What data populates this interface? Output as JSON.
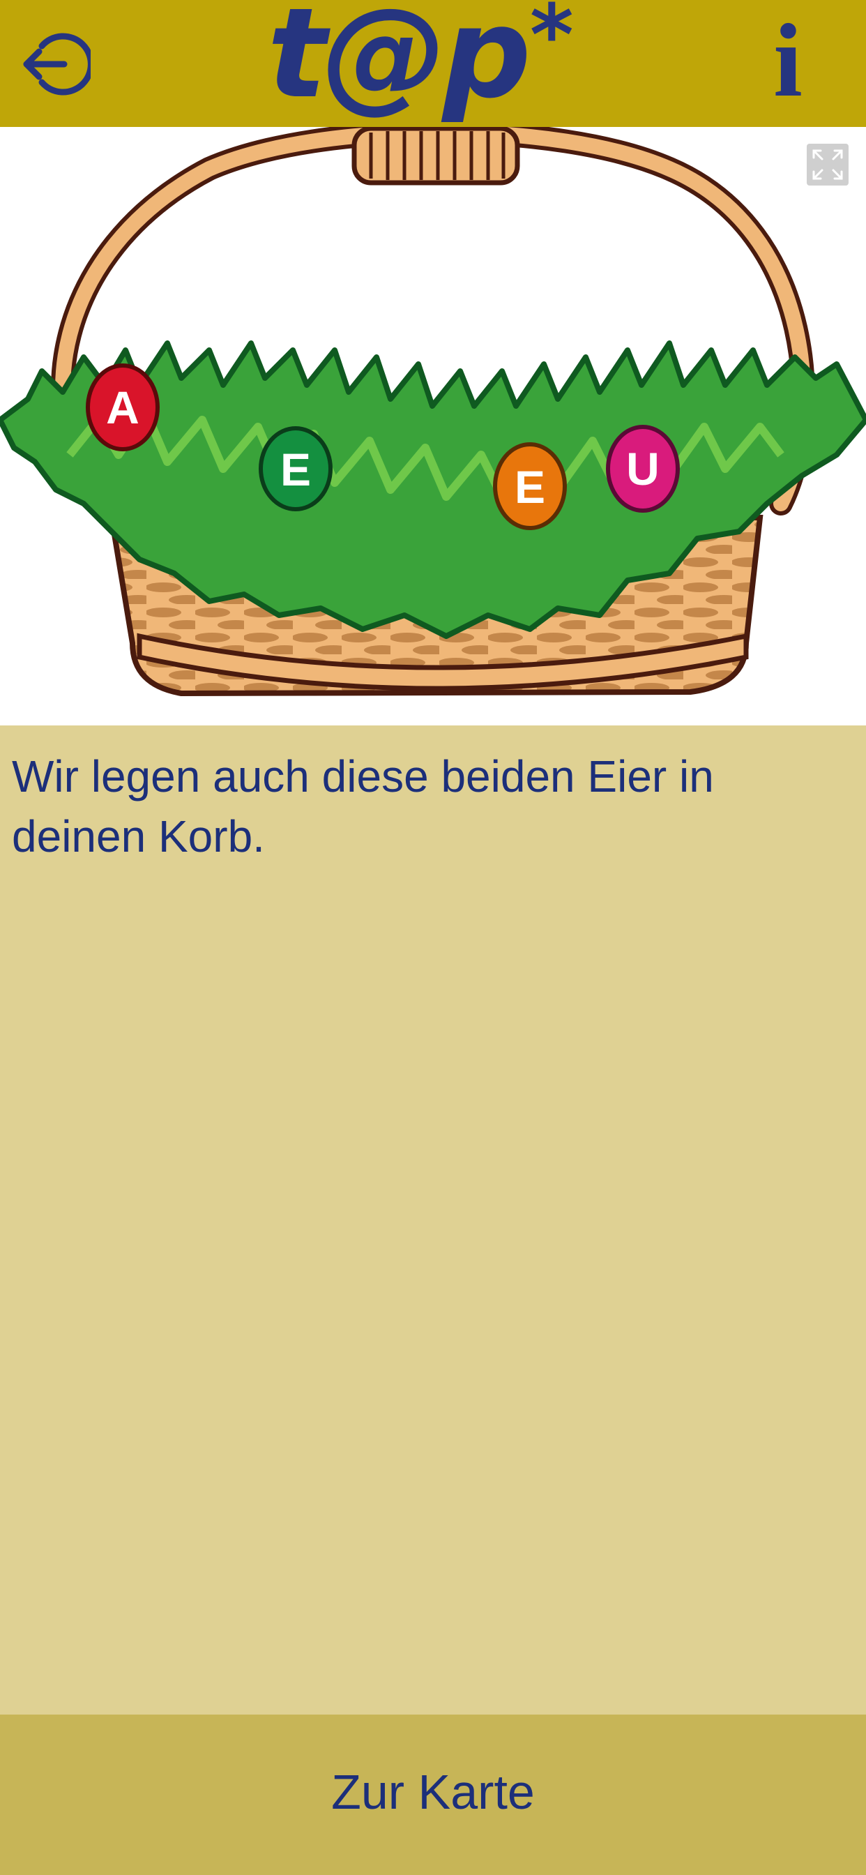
{
  "header": {
    "logo_text": "t@p",
    "logo_star": "*",
    "back_icon": "logout-arrow-icon",
    "info_label": "i",
    "accent_color": "#bfa608",
    "text_color": "#263580"
  },
  "image": {
    "eggs": [
      {
        "letter": "A",
        "color": "#d9142a"
      },
      {
        "letter": "E",
        "color": "#149040"
      },
      {
        "letter": "E",
        "color": "#e8760c"
      },
      {
        "letter": "U",
        "color": "#d91b7c"
      }
    ],
    "expand_icon": "fullscreen-icon"
  },
  "content": {
    "message": "Wir legen auch diese beiden Eier in deinen Korb."
  },
  "footer": {
    "button_label": "Zur Karte"
  }
}
